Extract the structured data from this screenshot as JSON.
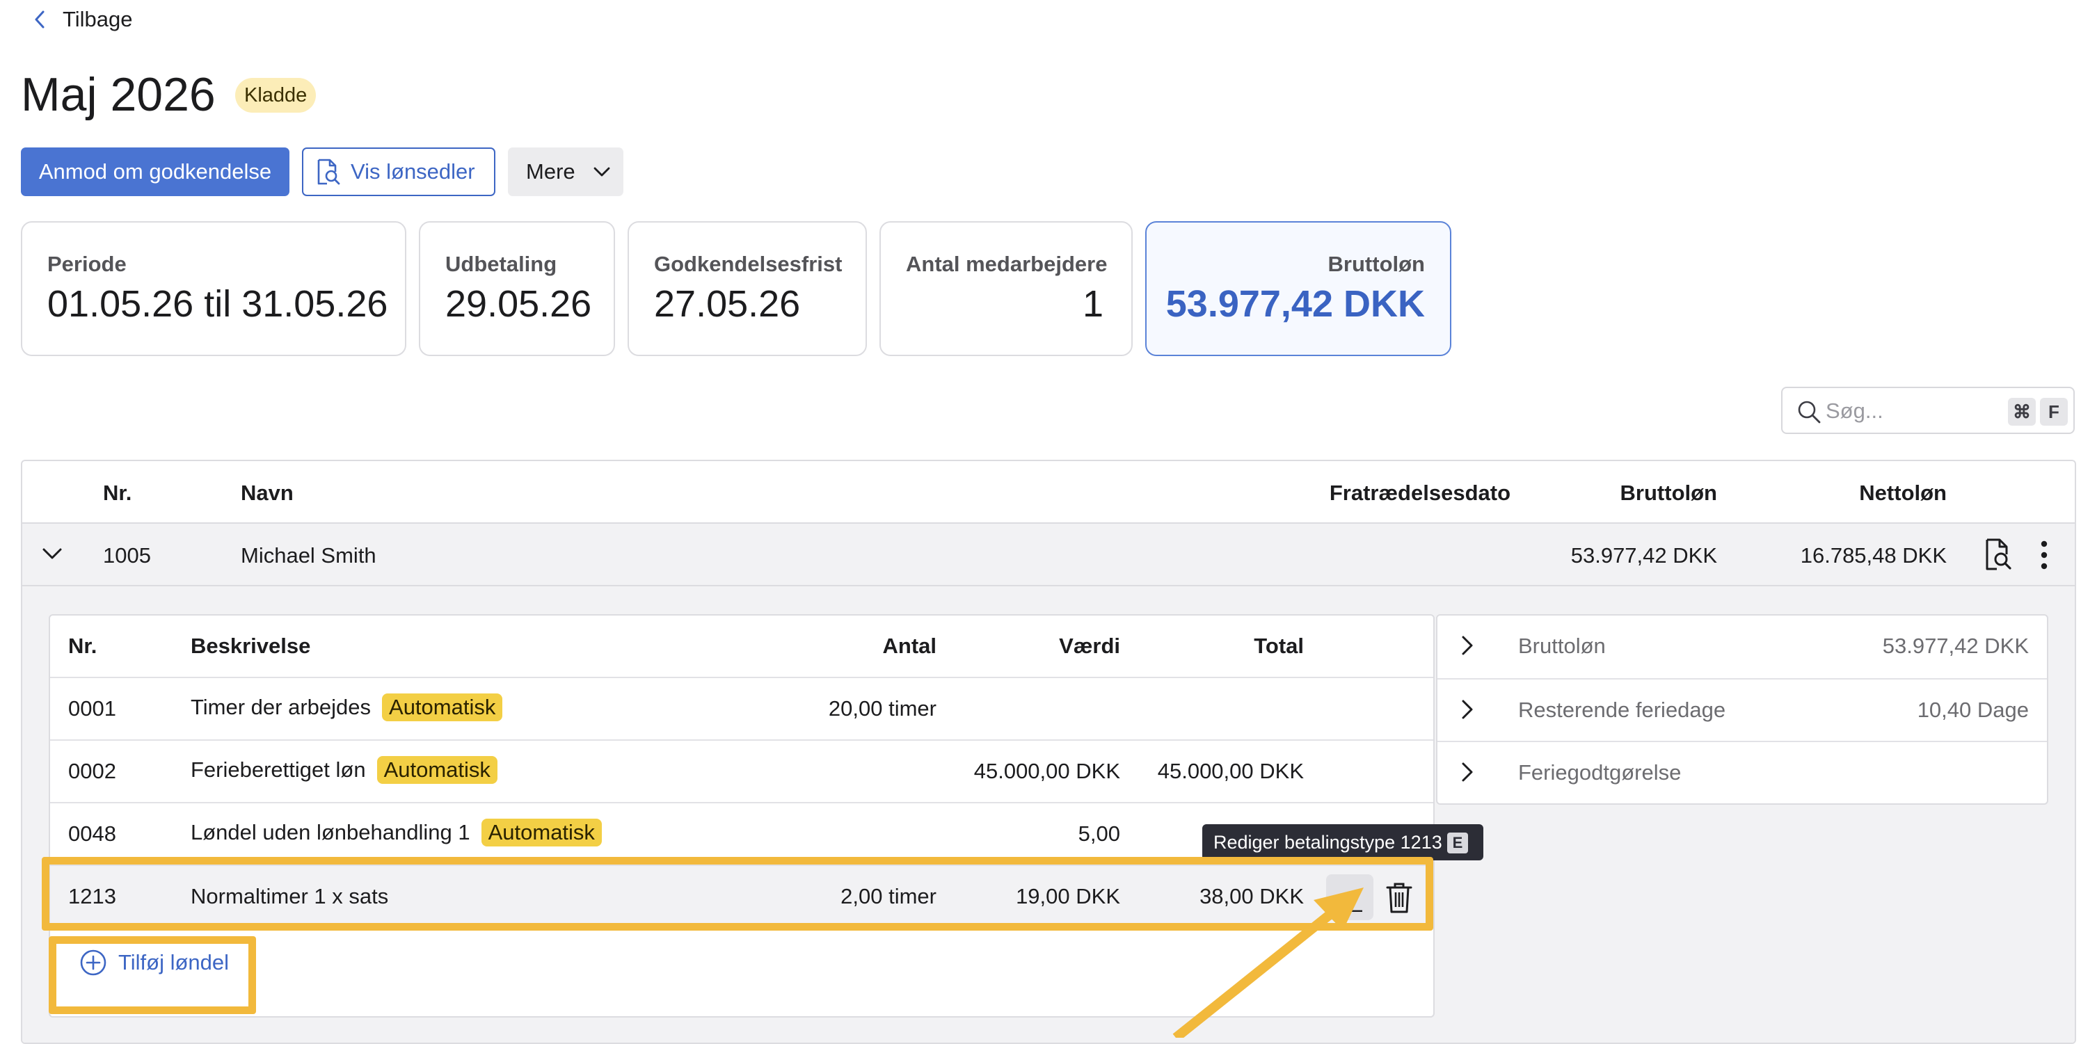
{
  "back_link": {
    "label": "Tilbage"
  },
  "header": {
    "title": "Maj 2026",
    "status_badge": "Kladde"
  },
  "actions": {
    "request_approval": "Anmod om godkendelse",
    "view_payslips": "Vis lønsedler",
    "more": "Mere"
  },
  "summary_cards": {
    "period": {
      "label": "Periode",
      "value": "01.05.26 til 31.05.26"
    },
    "payout": {
      "label": "Udbetaling",
      "value": "29.05.26"
    },
    "deadline": {
      "label": "Godkendelsesfrist",
      "value": "27.05.26"
    },
    "employees": {
      "label": "Antal medarbejdere",
      "value": "1"
    },
    "gross": {
      "label": "Bruttoløn",
      "value": "53.977,42 DKK"
    }
  },
  "search": {
    "placeholder": "Søg...",
    "shortcut_cmd": "⌘",
    "shortcut_key": "F"
  },
  "table": {
    "columns": {
      "nr": "Nr.",
      "name": "Navn",
      "termination": "Fratrædelsesdato",
      "gross": "Bruttoløn",
      "net": "Nettoløn"
    },
    "employee": {
      "nr": "1005",
      "name": "Michael Smith",
      "gross": "53.977,42 DKK",
      "net": "16.785,48 DKK"
    }
  },
  "components": {
    "columns": {
      "nr": "Nr.",
      "description": "Beskrivelse",
      "quantity": "Antal",
      "value": "Værdi",
      "total": "Total"
    },
    "auto_badge": "Automatisk",
    "rows": [
      {
        "nr": "0001",
        "description": "Timer der arbejdes",
        "quantity": "20,00 timer",
        "value": "",
        "total": ""
      },
      {
        "nr": "0002",
        "description": "Ferieberettiget løn",
        "quantity": "",
        "value": "45.000,00 DKK",
        "total": "45.000,00 DKK"
      },
      {
        "nr": "0048",
        "description": "Løndel uden lønbehandling 1",
        "quantity": "",
        "value": "5,00",
        "total": ""
      },
      {
        "nr": "1213",
        "description": "Normaltimer 1 x sats",
        "quantity": "2,00 timer",
        "value": "19,00 DKK",
        "total": "38,00 DKK"
      }
    ],
    "add_label": "Tilføj løndel"
  },
  "side_summary": [
    {
      "label": "Bruttoløn",
      "value": "53.977,42 DKK"
    },
    {
      "label": "Resterende feriedage",
      "value": "10,40 Dage"
    },
    {
      "label": "Feriegodtgørelse",
      "value": ""
    }
  ],
  "tooltip": {
    "text": "Rediger betalingstype 1213",
    "shortcut": "E"
  },
  "colors": {
    "primary": "#4a74d2",
    "badge_draft": "#fcedb8",
    "badge_auto": "#f3cf45",
    "annotation": "#f2b93c",
    "tooltip_bg": "#2c2d36"
  }
}
